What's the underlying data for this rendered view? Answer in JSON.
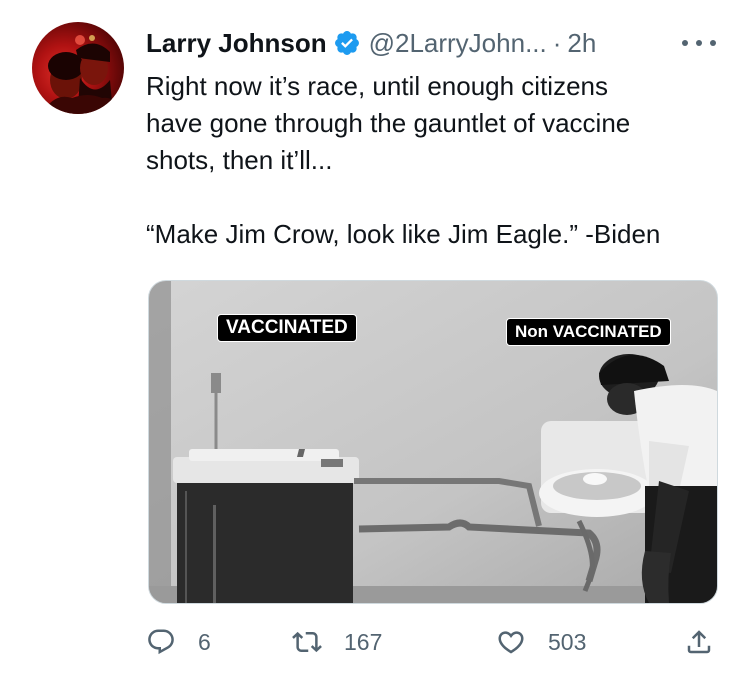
{
  "author": {
    "name": "Larry Johnson",
    "handle": "@2LarryJohn...",
    "separator": "·",
    "time": "2h",
    "verified": true
  },
  "tweet": {
    "text": "Right now it’s race, until enough citizens\nhave gone through the gauntlet of vaccine\nshots, then it’ll...\n\n“Make Jim Crow, look like Jim Eagle.” -Biden"
  },
  "media": {
    "labels": {
      "left": "VACCINATED",
      "right": "Non VACCINATED"
    }
  },
  "actions": {
    "replies": "6",
    "retweets": "167",
    "likes": "503"
  },
  "icons": {
    "more": "more-icon",
    "reply": "reply-icon",
    "retweet": "retweet-icon",
    "like": "heart-icon",
    "share": "share-icon",
    "verified": "verified-badge-icon"
  },
  "colors": {
    "text": "#0f1419",
    "secondary": "#536471",
    "verified": "#1d9bf0",
    "border": "#cfd9de"
  }
}
